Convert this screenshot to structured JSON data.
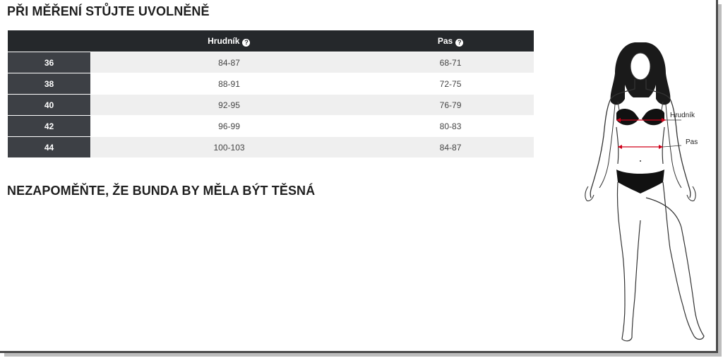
{
  "heading_top": "PŘI MĚŘENÍ STŮJTE UVOLNĚNĚ",
  "heading_bottom": "NEZAPOMĚŇTE, ŽE BUNDA BY MĚLA BÝT TĚSNÁ",
  "table": {
    "columns": [
      "Hrudník",
      "Pas"
    ],
    "help_glyph": "?",
    "rows": [
      {
        "size": "36",
        "chest": "84-87",
        "waist": "68-71"
      },
      {
        "size": "38",
        "chest": "88-91",
        "waist": "72-75"
      },
      {
        "size": "40",
        "chest": "92-95",
        "waist": "76-79"
      },
      {
        "size": "42",
        "chest": "96-99",
        "waist": "80-83"
      },
      {
        "size": "44",
        "chest": "100-103",
        "waist": "84-87"
      }
    ]
  },
  "figure": {
    "chest_label": "Hrudník",
    "waist_label": "Pas",
    "measure_color": "#d0021b"
  }
}
